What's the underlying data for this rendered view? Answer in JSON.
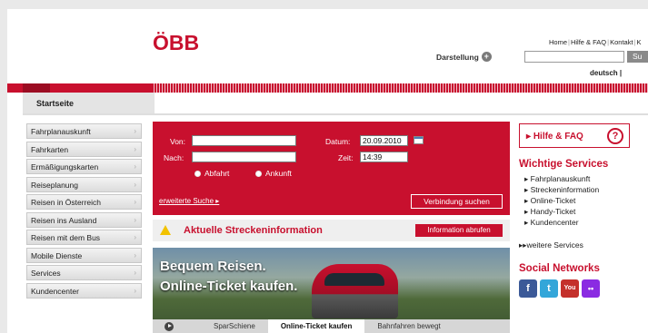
{
  "header": {
    "logo": "ÖBB",
    "darstellung": "Darstellung",
    "top_links": [
      "Home",
      "Hilfe & FAQ",
      "Kontakt",
      "K"
    ],
    "search_button": "Su",
    "lang": "deutsch |"
  },
  "tab": {
    "label": "Startseite"
  },
  "sidebar": {
    "items": [
      {
        "label": "Fahrplanauskunft"
      },
      {
        "label": "Fahrkarten"
      },
      {
        "label": "Ermäßigungskarten"
      },
      {
        "label": "Reiseplanung"
      },
      {
        "label": "Reisen in Österreich"
      },
      {
        "label": "Reisen ins Ausland"
      },
      {
        "label": "Reisen mit dem Bus"
      },
      {
        "label": "Mobile Dienste"
      },
      {
        "label": "Services"
      },
      {
        "label": "Kundencenter"
      }
    ]
  },
  "form": {
    "von_label": "Von:",
    "nach_label": "Nach:",
    "datum_label": "Datum:",
    "datum_value": "20.09.2010",
    "zeit_label": "Zeit:",
    "zeit_value": "14:39",
    "abfahrt": "Abfahrt",
    "ankunft": "Ankunft",
    "advanced": "erweiterte Suche",
    "submit": "Verbindung suchen"
  },
  "info": {
    "title": "Aktuelle Streckeninformation",
    "button": "Information abrufen"
  },
  "banner": {
    "line1": "Bequem Reisen.",
    "line2": "Online-Ticket kaufen.",
    "tabs": [
      "SparSchiene",
      "Online-Ticket kaufen",
      "Bahnfahren bewegt"
    ]
  },
  "right": {
    "help": "Hilfe & FAQ",
    "help_icon": "?",
    "services_title": "Wichtige Services",
    "services": [
      "Fahrplanauskunft",
      "Streckeninformation",
      "Online-Ticket",
      "Handy-Ticket",
      "Kundencenter"
    ],
    "more": "weitere Services",
    "social_title": "Social Networks",
    "social": [
      "f",
      "t",
      "You",
      "••"
    ]
  },
  "colors": {
    "brand": "#c8102e"
  }
}
